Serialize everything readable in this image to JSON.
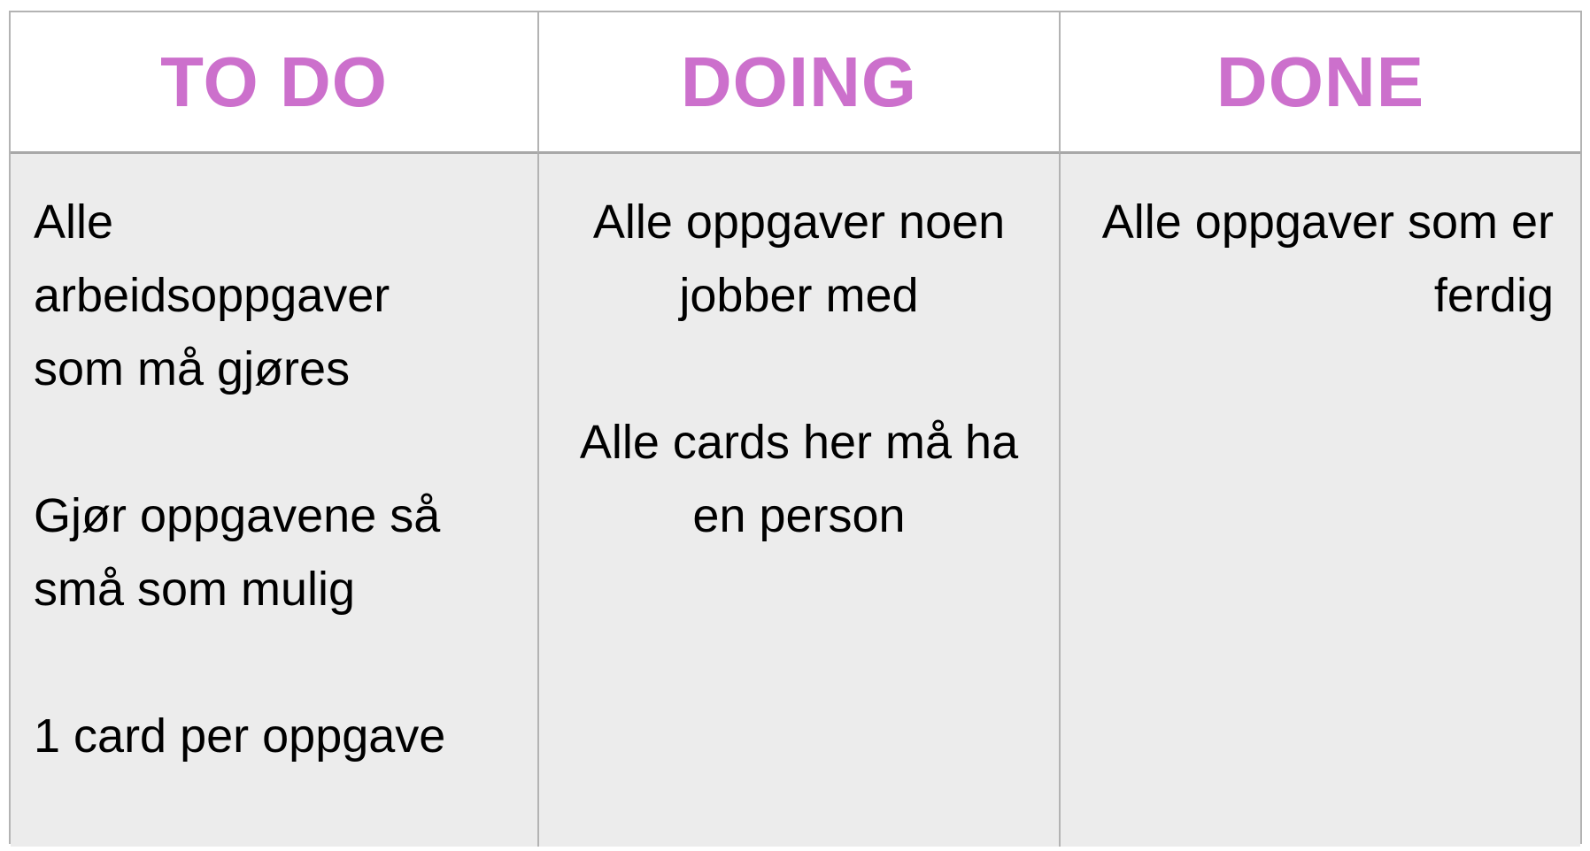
{
  "columns": [
    {
      "title": "TO DO",
      "paragraphs": [
        "Alle arbeidsoppgaver som må gjøres",
        "Gjør oppgavene så små som mulig",
        "1 card per oppgave"
      ]
    },
    {
      "title": "DOING",
      "paragraphs": [
        "Alle oppgaver noen jobber med",
        "Alle cards her må ha en person"
      ]
    },
    {
      "title": "DONE",
      "paragraphs": [
        "Alle oppgaver som er ferdig"
      ]
    }
  ],
  "colors": {
    "title": "#cc70cc",
    "body_background": "#ececec",
    "header_background": "#ffffff",
    "border": "#b3b3b3"
  }
}
